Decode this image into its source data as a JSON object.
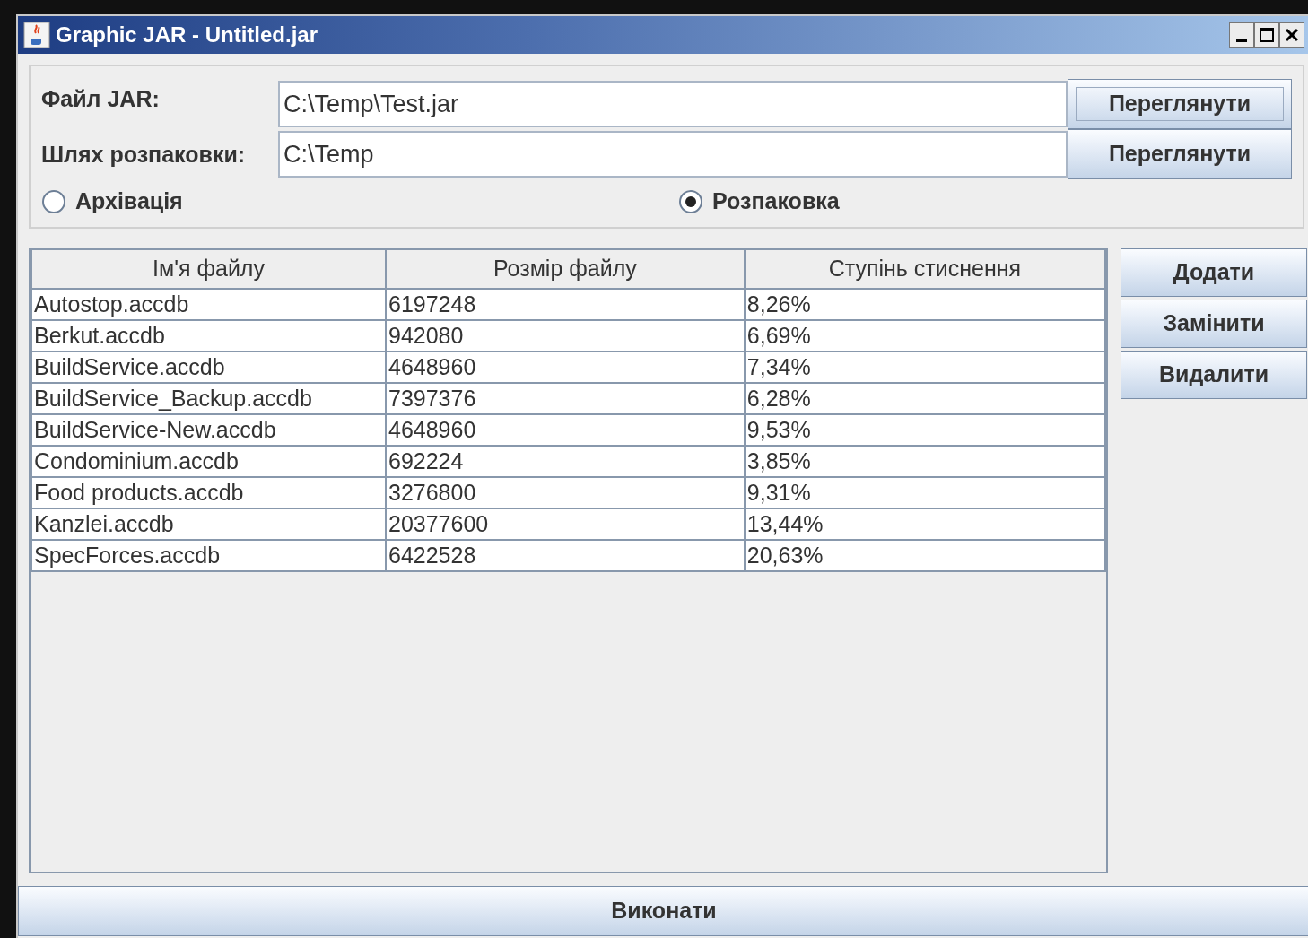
{
  "window": {
    "title": "Graphic JAR - Untitled.jar"
  },
  "fields": [
    {
      "label": "Файл JAR:",
      "value": "C:\\Temp\\Test.jar",
      "button": "Переглянути",
      "focused": true
    },
    {
      "label": "Шлях розпаковки:",
      "value": "C:\\Temp",
      "button": "Переглянути",
      "focused": false
    }
  ],
  "mode": [
    {
      "label": "Архівація",
      "selected": false
    },
    {
      "label": "Розпаковка",
      "selected": true
    }
  ],
  "table": {
    "columns": [
      "Ім'я файлу",
      "Розмір файлу",
      "Ступінь стиснення"
    ],
    "rows": [
      [
        "Autostop.accdb",
        "6197248",
        "8,26%"
      ],
      [
        "Berkut.accdb",
        "942080",
        "6,69%"
      ],
      [
        "BuildService.accdb",
        "4648960",
        "7,34%"
      ],
      [
        "BuildService_Backup.accdb",
        "7397376",
        "6,28%"
      ],
      [
        "BuildService-New.accdb",
        "4648960",
        "9,53%"
      ],
      [
        "Condominium.accdb",
        "692224",
        "3,85%"
      ],
      [
        "Food products.accdb",
        "3276800",
        "9,31%"
      ],
      [
        "Kanzlei.accdb",
        "20377600",
        "13,44%"
      ],
      [
        "SpecForces.accdb",
        "6422528",
        "20,63%"
      ]
    ]
  },
  "side_buttons": [
    "Додати",
    "Замінити",
    "Видалити"
  ],
  "run_button": "Виконати"
}
